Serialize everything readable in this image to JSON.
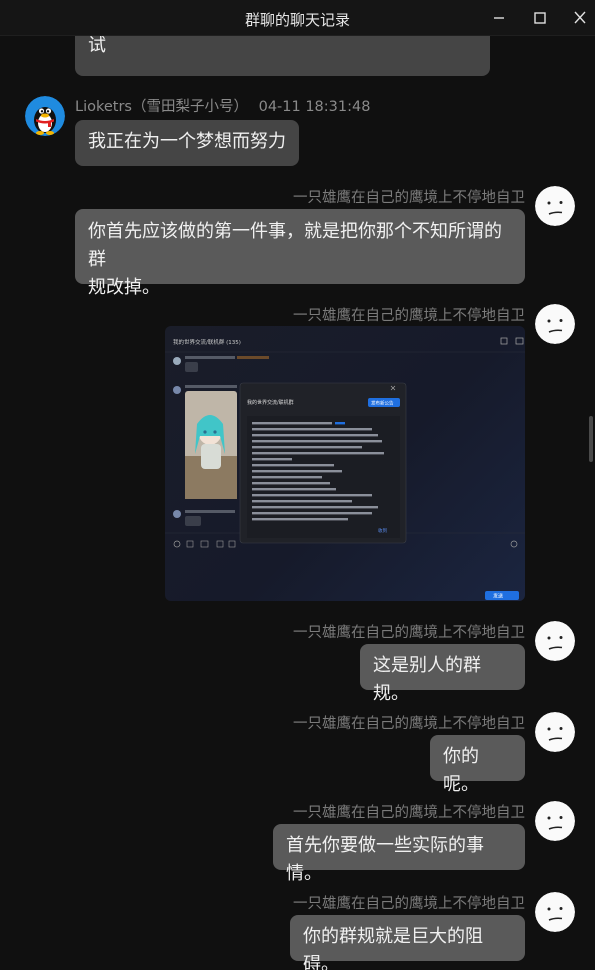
{
  "window": {
    "title": "群聊的聊天记录"
  },
  "messages": [
    {
      "id": "m0",
      "direction": "in",
      "text": "试"
    },
    {
      "id": "m1",
      "direction": "in",
      "sender": "Lioketrs（雪田梨子小号）",
      "time": "04-11 18:31:48",
      "text": "我正在为一个梦想而努力"
    },
    {
      "id": "m2",
      "direction": "out",
      "sender": "一只雄鹰在自己的鹰境上不停地自卫",
      "line1": "你首先应该做的第一件事，就是把你那个不知所谓的群",
      "line2": "规改掉。"
    },
    {
      "id": "m3",
      "direction": "out",
      "sender": "一只雄鹰在自己的鹰境上不停地自卫",
      "type": "image"
    },
    {
      "id": "m4",
      "direction": "out",
      "sender": "一只雄鹰在自己的鹰境上不停地自卫",
      "text": "这是别人的群规。"
    },
    {
      "id": "m5",
      "direction": "out",
      "sender": "一只雄鹰在自己的鹰境上不停地自卫",
      "text": "你的呢。"
    },
    {
      "id": "m6",
      "direction": "out",
      "sender": "一只雄鹰在自己的鹰境上不停地自卫",
      "text": "首先你要做一些实际的事情。"
    },
    {
      "id": "m7",
      "direction": "out",
      "sender": "一只雄鹰在自己的鹰境上不停地自卫",
      "text": "你的群规就是巨大的阻碍。"
    }
  ],
  "embedded_screenshot": {
    "group_title": "我的世界交流/联机群 (135)",
    "dialog_title": "我的世界交流/联机群",
    "dialog_button": "发布新公告",
    "send_label": "发送",
    "reply_label": "收到"
  },
  "icons": {
    "minimize": "minimize-icon",
    "maximize": "maximize-icon",
    "close": "close-icon",
    "qq_avatar": "qq-penguin-avatar",
    "face_avatar": "doodle-face-avatar"
  }
}
